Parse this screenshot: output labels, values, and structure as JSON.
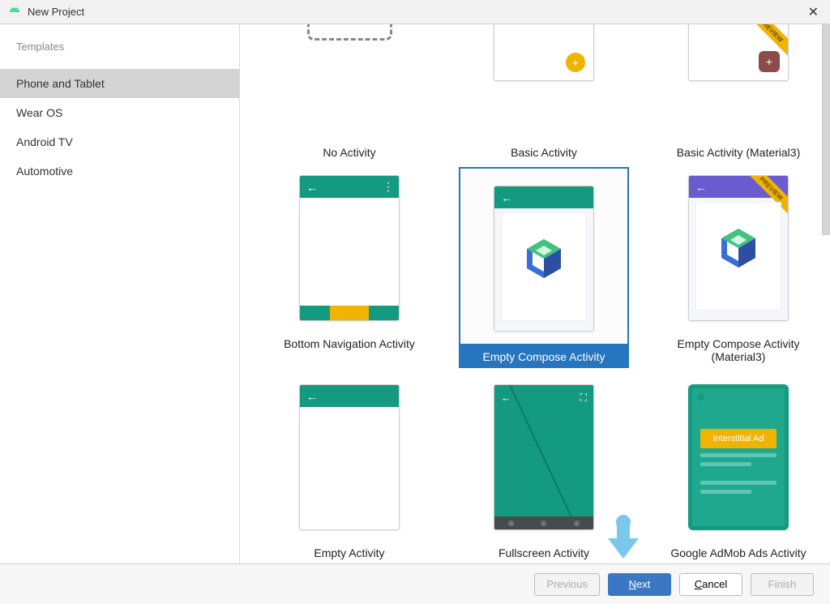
{
  "window": {
    "title": "New Project"
  },
  "sidebar": {
    "heading": "Templates",
    "items": [
      {
        "label": "Phone and Tablet",
        "selected": true
      },
      {
        "label": "Wear OS",
        "selected": false
      },
      {
        "label": "Android TV",
        "selected": false
      },
      {
        "label": "Automotive",
        "selected": false
      }
    ]
  },
  "templates": {
    "row1": [
      {
        "label": "No Activity"
      },
      {
        "label": "Basic Activity"
      },
      {
        "label": "Basic Activity (Material3)",
        "ribbon": "PREVIEW"
      }
    ],
    "row2": [
      {
        "label": "Bottom Navigation Activity"
      },
      {
        "label": "Empty Compose Activity",
        "selected": true
      },
      {
        "label": "Empty Compose Activity (Material3)",
        "ribbon": "PREVIEW"
      }
    ],
    "row3": [
      {
        "label": "Empty Activity"
      },
      {
        "label": "Fullscreen Activity"
      },
      {
        "label": "Google AdMob Ads Activity",
        "ad_label": "Interstitial Ad"
      }
    ]
  },
  "footer": {
    "previous": "Previous",
    "next": "Next",
    "cancel": "Cancel",
    "finish": "Finish"
  }
}
